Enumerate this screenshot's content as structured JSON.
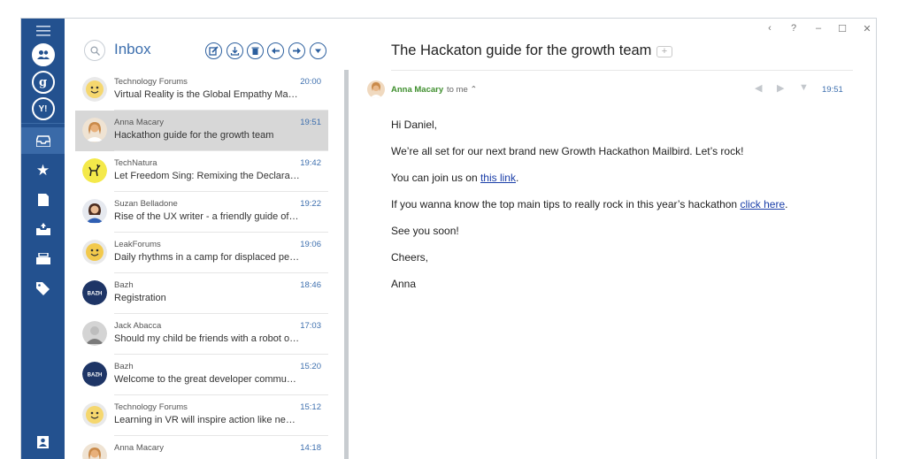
{
  "sidebar": {
    "items": [
      {
        "name": "menu-icon",
        "glyph": "☰"
      },
      {
        "name": "contacts-icon",
        "glyph": "👥"
      },
      {
        "name": "google-account-icon",
        "glyph": "g"
      },
      {
        "name": "yahoo-account-icon",
        "glyph": "Y!"
      },
      {
        "name": "inbox-icon",
        "glyph": "inbox"
      },
      {
        "name": "starred-icon",
        "glyph": "★"
      },
      {
        "name": "drafts-icon",
        "glyph": "doc"
      },
      {
        "name": "sent-icon",
        "glyph": "tray"
      },
      {
        "name": "archive-icon",
        "glyph": "box"
      },
      {
        "name": "tags-icon",
        "glyph": "tag"
      },
      {
        "name": "contacts-book-icon",
        "glyph": "book"
      }
    ]
  },
  "list": {
    "title": "Inbox",
    "messages": [
      {
        "from": "Technology Forums",
        "time": "20:00",
        "subject": "Virtual Reality is the Global Empathy Machine",
        "avatar": "emoji-face",
        "avatar_color": "#f5d76e"
      },
      {
        "from": "Anna Macary",
        "time": "19:51",
        "subject": "Hackathon guide for the growth team",
        "avatar": "photo-woman",
        "avatar_color": "#e8b07a"
      },
      {
        "from": "TechNatura",
        "time": "19:42",
        "subject": "Let Freedom Sing: Remixing the Declaration of Independence",
        "avatar": "deer",
        "avatar_color": "#f4e94a"
      },
      {
        "from": "Suzan Belladone",
        "time": "19:22",
        "subject": "Rise of the UX writer - a friendly guide of the new role",
        "avatar": "photo-woman-blue",
        "avatar_color": "#2f5fb3"
      },
      {
        "from": "LeakForums",
        "time": "19:06",
        "subject": "Daily rhythms in a camp for displaced people",
        "avatar": "lego-face",
        "avatar_color": "#f2c94c"
      },
      {
        "from": "Bazh",
        "time": "18:46",
        "subject": "Registration",
        "avatar": "bazh",
        "avatar_color": "#1e3566"
      },
      {
        "from": "Jack Abacca",
        "time": "17:03",
        "subject": "Should my child be friends with a robot or not?",
        "avatar": "photo-man",
        "avatar_color": "#9a9a9a"
      },
      {
        "from": "Bazh",
        "time": "15:20",
        "subject": "Welcome to the great developer community",
        "avatar": "bazh",
        "avatar_color": "#1e3566"
      },
      {
        "from": "Technology Forums",
        "time": "15:12",
        "subject": "Learning in VR will inspire action like never before",
        "avatar": "emoji-face",
        "avatar_color": "#f5d76e"
      },
      {
        "from": "Anna Macary",
        "time": "14:18",
        "subject": "",
        "avatar": "photo-woman",
        "avatar_color": "#e8b07a"
      }
    ],
    "bazh_label": "BAZH"
  },
  "reader": {
    "window_controls": [
      "‹",
      "?",
      "–",
      "☐",
      "✕"
    ],
    "title": "The Hackaton guide for the growth team",
    "sender": "Anna Macary",
    "to": "to me ⌃",
    "time": "19:51",
    "body": {
      "greeting": "Hi Daniel,",
      "line1": "We’re all set for our next brand new Growth Hackathon Mailbird. Let’s rock!",
      "line2_pre": "You can join us on ",
      "line2_link": "this link",
      "line2_post": ".",
      "line3_pre": "If you wanna know the top main tips to really rock in this year’s hackathon ",
      "line3_link": "click here",
      "line3_post": ".",
      "line4": "See you soon!",
      "line5": "Cheers,",
      "signature": "Anna"
    }
  },
  "colors": {
    "sidebar": "#23518f",
    "accent": "#3d6fae",
    "sender_green": "#3f8f2e",
    "selected_row": "#d7d7d7"
  }
}
